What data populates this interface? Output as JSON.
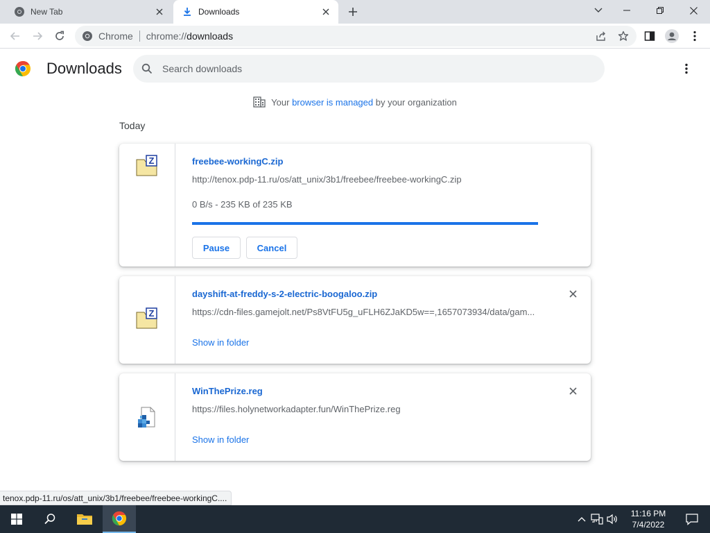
{
  "tabs": [
    {
      "title": "New Tab",
      "active": false
    },
    {
      "title": "Downloads",
      "active": true
    }
  ],
  "toolbar": {
    "site_chip": "Chrome",
    "url_scheme": "chrome://",
    "url_host": "downloads"
  },
  "page": {
    "title": "Downloads",
    "search_placeholder": "Search downloads"
  },
  "managed": {
    "prefix": "Your ",
    "link": "browser is managed",
    "suffix": " by your organization"
  },
  "section_label": "Today",
  "downloads": [
    {
      "name": "freebee-workingC.zip",
      "url": "http://tenox.pdp-11.ru/os/att_unix/3b1/freebee/freebee-workingC.zip",
      "status": "0 B/s - 235 KB of 235 KB",
      "progress": 1.0,
      "pause_label": "Pause",
      "cancel_label": "Cancel",
      "icon": "zip-file-icon"
    },
    {
      "name": "dayshift-at-freddy-s-2-electric-boogaloo.zip",
      "url": "https://cdn-files.gamejolt.net/Ps8VtFU5g_uFLH6ZJaKD5w==,1657073934/data/gam...",
      "action_label": "Show in folder",
      "icon": "zip-file-icon"
    },
    {
      "name": "WinThePrize.reg",
      "url": "https://files.holynetworkadapter.fun/WinThePrize.reg",
      "action_label": "Show in folder",
      "icon": "registry-file-icon"
    }
  ],
  "status_bubble": "tenox.pdp-11.ru/os/att_unix/3b1/freebee/freebee-workingC....",
  "taskbar": {
    "time": "11:16 PM",
    "date": "7/4/2022"
  },
  "colors": {
    "accent": "#1a73e8",
    "link": "#1967d2",
    "taskbar": "#1f2a35"
  }
}
